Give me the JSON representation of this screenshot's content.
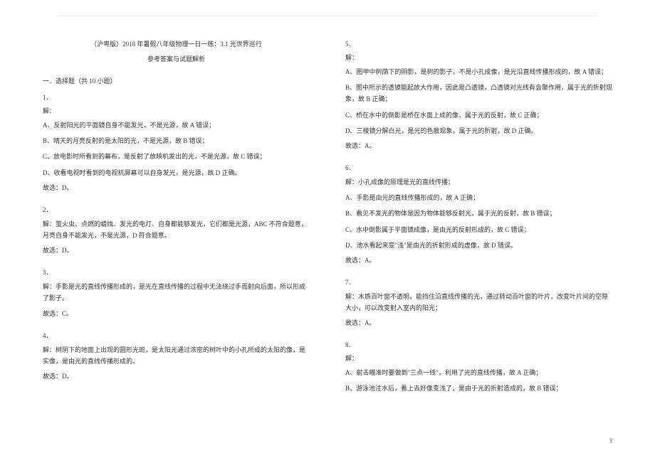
{
  "header": {
    "title": "（沪粤版）2018 年暑假八年级物理一日一练：3.1 光世界巡行",
    "subtitle": "参考答案与试题解析"
  },
  "section_head": "一．选择题（共 10 小题）",
  "questions": [
    {
      "num": "1．",
      "label": "解：",
      "lines": [
        "A、反射阳光的平面镜自身不能发光，不是光源，故 A 错误；",
        "B、晴天的月亮反射的是太阳的光，不是光源，故 B 错误；",
        "C、放电影时所看到的幕布，是反射了放映机发出的光，不是光源，故 C 错误；",
        "D、收看电视时看到的电视机屏幕可以自身发光，是光源，故 D 正确。"
      ],
      "answer": "故选：D。"
    },
    {
      "num": "2．",
      "label": "解：",
      "lines": [
        "解：萤火虫、点燃的蜡烛、发光的电灯、自身都能够发光，它们都是光源，ABC 不符合题意，月亮自身不能发光，不是光源，D 符合题意。"
      ],
      "answer": "故选：D。"
    },
    {
      "num": "3．",
      "label": "",
      "lines": [
        "解：手影是光的直线传播形成的，是光在直线传播的过程中无法绕过手而射向后面，所以形成了影子。"
      ],
      "answer": "故选：C。"
    },
    {
      "num": "4．",
      "label": "",
      "lines": [
        "解：树阴下的地面上出现的圆形光斑，是太阳光通过浓密的树叶中的小孔所成的太阳的像，是实像，是由光的直线传播形成的。"
      ],
      "answer": "故选：D。"
    },
    {
      "num": "5．",
      "label": "解：",
      "lines": [
        "A、图甲中树荫下的阴影，是树的影子，不是小孔成像，是光沿直线传播形成的，故 A 错误；",
        "B、图中所示的透镜能起放大作用，因此是凸透镜，凸透镜对光线有会聚作用，属于光的折射现象，故 B 正确；",
        "C、桥在水中的倒影是桥在水面上成的像，属于光的反射，故 C 正确；",
        "D、三棱镜分解白光，是光的色散现象，属于光的折射，故 D 正确。"
      ],
      "answer": "故选：A。"
    },
    {
      "num": "6．",
      "label": "",
      "lines": [
        "解：小孔成像的原理是光的直线传播；",
        "A、手影是由光的直线传播形成的，故 A 正确；",
        "B、看见不发光的物体是因为物体能够反射光，属于光的反射，故 B 错误；",
        "C、水中倒影属于平面镜成像，是由光的反射形成的，故 C 错误；",
        "D、池水看起来变\"浅\"是由光的折射形成的虚像，故 D 错误。"
      ],
      "answer": "故选：A。"
    },
    {
      "num": "7．",
      "label": "",
      "lines": [
        "解：木质百叶窗不透明，能挡住沿直线传播的光，通过转动百叶窗的叶片，改变叶片间的空隙大小，可以改变射入室内的阳光；"
      ],
      "answer": "故选：A。"
    },
    {
      "num": "8．",
      "label": "解：",
      "lines": [
        "A、射击瞄准时要做到\"三点一线\"，利用了光的直线传播，故 A 正确；",
        "B、游泳池注水后，看上去好像变浅了，是由于光的折射造成的，故 B 错误；"
      ],
      "answer": ""
    }
  ],
  "page_number": "3"
}
